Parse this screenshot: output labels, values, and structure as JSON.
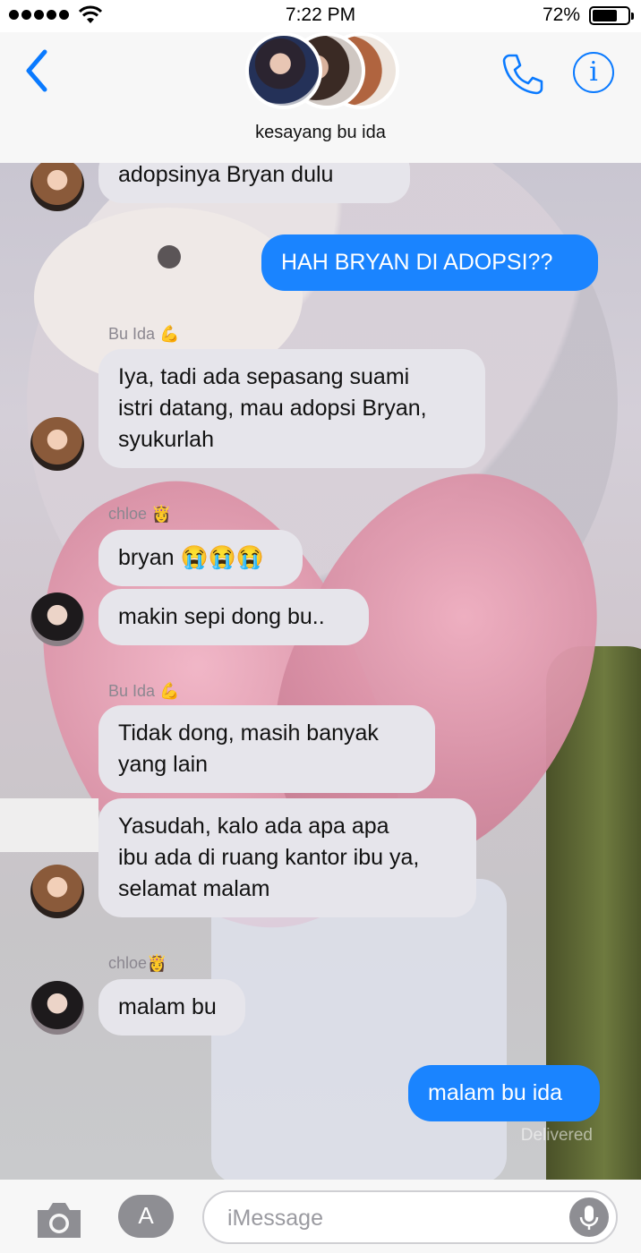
{
  "status_bar": {
    "time": "7:22 PM",
    "battery": "72%",
    "battery_level": 0.72
  },
  "header": {
    "title": "kesayang bu ida"
  },
  "messages": [
    {
      "side": "in",
      "text": "adopsinya Bryan dulu",
      "avatar": "ida"
    },
    {
      "side": "out",
      "text": "HAH BRYAN DI ADOPSI??"
    },
    {
      "sender": "Bu Ida 💪"
    },
    {
      "side": "in",
      "text": "Iya, tadi ada sepasang suami\nistri datang, mau adopsi Bryan,\nsyukurlah",
      "avatar": "ida"
    },
    {
      "sender": "chloe 👸"
    },
    {
      "side": "in",
      "text": "bryan 😭😭😭"
    },
    {
      "side": "in",
      "text": "makin sepi dong bu..",
      "avatar": "chloe"
    },
    {
      "sender": "Bu Ida 💪"
    },
    {
      "side": "in",
      "text": "Tidak dong, masih banyak\nyang lain"
    },
    {
      "side": "in",
      "text": "Yasudah, kalo ada apa apa\nibu ada di ruang kantor ibu ya,\nselamat malam",
      "avatar": "ida"
    },
    {
      "sender": "chloe👸"
    },
    {
      "side": "in",
      "text": "malam bu",
      "avatar": "chloe"
    },
    {
      "side": "out",
      "text": "malam bu ida"
    }
  ],
  "delivered": "Delivered",
  "input_bar": {
    "placeholder": "iMessage"
  },
  "colors": {
    "accent": "#0a7aff",
    "outgoing_bubble": "#1a84ff",
    "incoming_bubble": "#e6e5eb"
  }
}
